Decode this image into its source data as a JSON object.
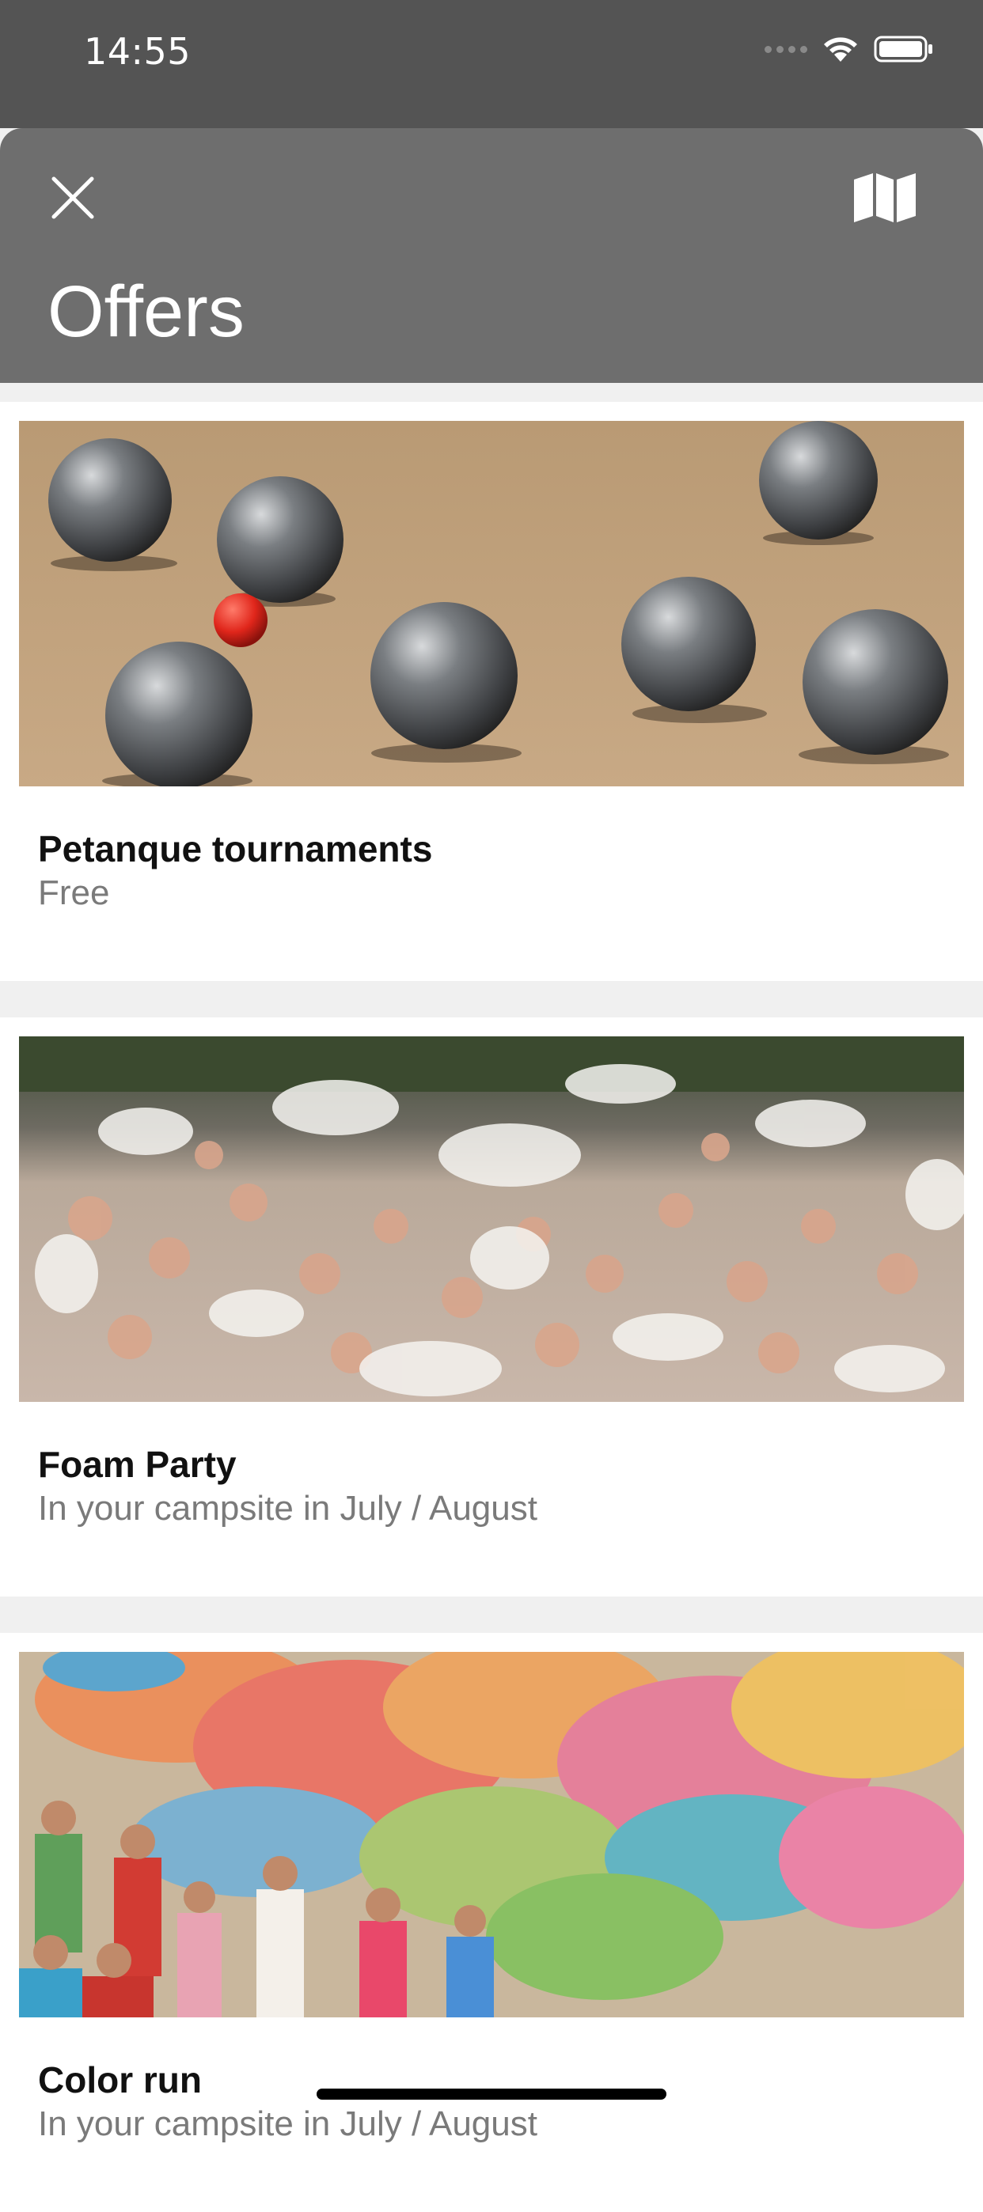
{
  "status_bar": {
    "time": "14:55",
    "icons": [
      "signal-dots-icon",
      "wifi-icon",
      "battery-icon"
    ]
  },
  "header": {
    "title": "Offers",
    "close_icon": "close-icon",
    "map_icon": "map-icon"
  },
  "offers": [
    {
      "title": "Petanque tournaments",
      "subtitle": "Free",
      "image": "petanque-balls-photo"
    },
    {
      "title": "Foam Party",
      "subtitle": "In your campsite in July / August",
      "image": "foam-party-photo"
    },
    {
      "title": "Color run",
      "subtitle": "In your campsite in July / August",
      "image": "color-run-photo"
    }
  ],
  "colors": {
    "status_bar": "#545454",
    "header": "#6e6e6e",
    "list_background": "#f0f0f0",
    "card": "#ffffff",
    "subtitle": "#7a7a7a"
  }
}
